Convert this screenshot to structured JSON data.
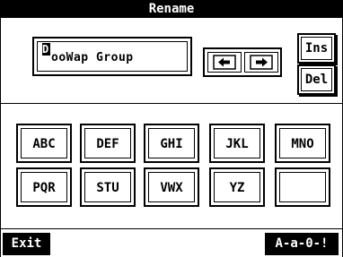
{
  "title": "Rename",
  "name_field": {
    "value": "DooWap Group"
  },
  "nav": {
    "left_icon": "arrow-left-icon",
    "right_icon": "arrow-right-icon"
  },
  "side_buttons": {
    "insert": "Ins",
    "delete": "Del"
  },
  "keys": [
    [
      "ABC",
      "DEF",
      "GHI",
      "JKL",
      "MNO"
    ],
    [
      "PQR",
      "STU",
      "VWX",
      "YZ",
      ""
    ]
  ],
  "footer": {
    "exit": "Exit",
    "char_mode": "A-a-0-!"
  }
}
